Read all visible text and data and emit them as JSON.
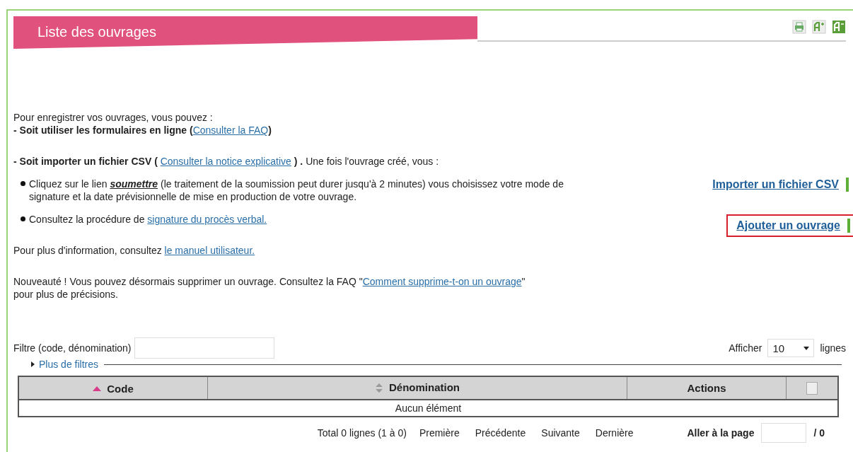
{
  "header": {
    "title": "Liste des ouvrages",
    "tools": [
      {
        "kind": "print"
      },
      {
        "kind": "larger"
      },
      {
        "kind": "smaller"
      }
    ]
  },
  "intro": [
    {
      "kind": "plain",
      "segments": [
        {
          "kind": "text",
          "text": "Pour enregistrer vos ouvrages, vous pouvez :"
        }
      ]
    },
    {
      "kind": "plain",
      "segments": [
        {
          "kind": "text",
          "text": "**- Soit utiliser les formulaires en ligne (**"
        },
        {
          "kind": "link",
          "text": "Consulter la FAQ"
        },
        {
          "kind": "text",
          "text": "**)**"
        }
      ]
    },
    {
      "kind": "gap",
      "segments": [
        {
          "kind": "text",
          "text": "**- Soit importer un fichier CSV (** "
        },
        {
          "kind": "link",
          "text": "Consulter la notice explicative"
        },
        {
          "kind": "text",
          "text": " **) .** Une fois l'ouvrage créé, vous :"
        }
      ]
    },
    {
      "kind": "bullet",
      "segments": [
        {
          "kind": "text",
          "text": "Cliquez sur le lien **soumettre** (le traitement de la soumission peut durer jusqu'à 2 minutes) vous choisissez votre mode de signature et la date prévisionnelle de mise en production de votre ouvrage."
        }
      ]
    },
    {
      "kind": "bullet",
      "segments": [
        {
          "kind": "text",
          "text": "Consultez la procédure de "
        },
        {
          "kind": "link",
          "text": "signature du procès verbal."
        }
      ]
    },
    {
      "kind": "gap",
      "segments": [
        {
          "kind": "text",
          "text": "Pour plus d'information, consultez "
        },
        {
          "kind": "link",
          "text": "le manuel utilisateur."
        }
      ]
    },
    {
      "kind": "gap",
      "segments": [
        {
          "kind": "text",
          "text": "Nouveauté ! Vous pouvez désormais supprimer un ouvrage. Consultez la FAQ \""
        },
        {
          "kind": "link",
          "text": "Comment supprime-t-on un ouvrage"
        },
        {
          "kind": "text",
          "text": "\" pour plus de précisions."
        }
      ]
    }
  ],
  "actions": [
    {
      "label": "Importer un fichier CSV",
      "highlighted": false
    },
    {
      "label": "Ajouter un ouvrage",
      "highlighted": true
    }
  ],
  "filter": {
    "label": "Filtre (code, dénomination)",
    "more_filters": "Plus de filtres",
    "expanded": false
  },
  "page_size": {
    "label": "Afficher",
    "value": "10",
    "suffix": "lignes"
  },
  "table": {
    "columns": [
      {
        "label": "Code",
        "kind": "sorted"
      },
      {
        "label": "Dénomination",
        "kind": "sortable"
      },
      {
        "label": "Actions",
        "kind": "plain"
      }
    ],
    "select_all": {
      "checked": false
    },
    "empty": "Aucun élément"
  },
  "pager": {
    "total": "Total 0 lignes (1 à 0)",
    "links": [
      "Première",
      "Précédente",
      "Suivante",
      "Dernière"
    ],
    "goto_label": "Aller à la page",
    "page_count": "/ 0"
  }
}
